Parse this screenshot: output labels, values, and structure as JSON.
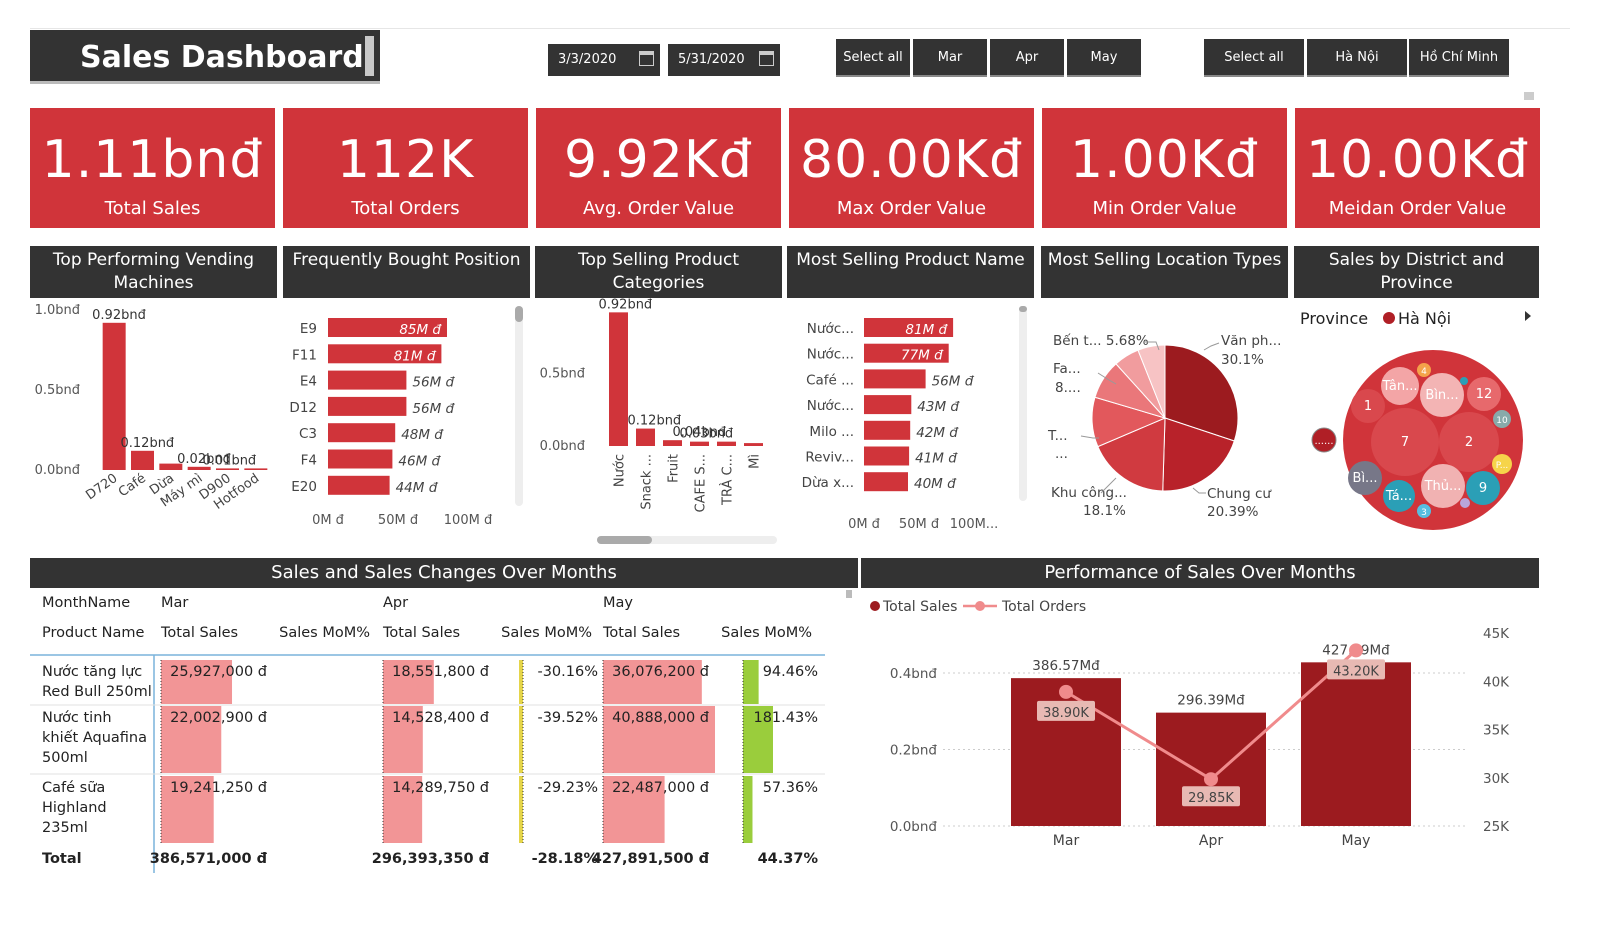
{
  "title": "Sales Dashboard",
  "dates": {
    "start": "3/3/2020",
    "end": "5/31/2020"
  },
  "month_slicer": [
    "Select all",
    "Mar",
    "Apr",
    "May"
  ],
  "city_slicer": [
    "Select all",
    "Hà Nội",
    "Hồ Chí Minh"
  ],
  "kpis": [
    {
      "value": "1.11bnđ",
      "label": "Total Sales"
    },
    {
      "value": "112K",
      "label": "Total Orders"
    },
    {
      "value": "9.92Kđ",
      "label": "Avg. Order Value"
    },
    {
      "value": "80.00Kđ",
      "label": "Max Order Value"
    },
    {
      "value": "1.00Kđ",
      "label": "Min Order Value"
    },
    {
      "value": "10.00Kđ",
      "label": "Meidan Order Value"
    }
  ],
  "panel_titles": {
    "vending": "Top Performing Vending Machines",
    "position": "Frequently Bought Position",
    "categories": "Top Selling Product Categories",
    "product": "Most Selling Product Name",
    "location": "Most Selling Location Types",
    "district": "Sales by District and Province",
    "table": "Sales and Sales Changes Over Months",
    "performance": "Performance of Sales Over Months"
  },
  "chart_data": [
    {
      "type": "bar",
      "title": "Top Performing Vending Machines",
      "categories": [
        "D720",
        "Café",
        "Dừa",
        "Máy mì",
        "D900",
        "Hotfood"
      ],
      "values": [
        0.92,
        0.12,
        0.04,
        0.02,
        0.01,
        0.01
      ],
      "data_labels": [
        "0.92bnđ",
        "0.12bnđ",
        "",
        "0.02bnđ",
        "0.01bnđ",
        ""
      ],
      "y_ticks": [
        "1.0bnđ",
        "0.5bnđ",
        "0.0bnđ"
      ],
      "ylim": [
        0,
        1.0
      ]
    },
    {
      "type": "bar",
      "orientation": "horizontal",
      "title": "Frequently Bought Position",
      "categories": [
        "E9",
        "F11",
        "E4",
        "D12",
        "C3",
        "F4",
        "E20"
      ],
      "values": [
        85,
        81,
        56,
        56,
        48,
        46,
        44
      ],
      "data_labels": [
        "85M đ",
        "81M đ",
        "56M đ",
        "56M đ",
        "48M đ",
        "46M đ",
        "44M đ"
      ],
      "x_ticks": [
        "0M đ",
        "50M đ",
        "100M đ"
      ],
      "xlim": [
        0,
        100
      ]
    },
    {
      "type": "bar",
      "title": "Top Selling Product Categories",
      "categories": [
        "Nước",
        "Snack ...",
        "Fruit",
        "CAFE S...",
        "TRÀ C...",
        "Mì"
      ],
      "values": [
        0.92,
        0.12,
        0.04,
        0.03,
        0.03,
        0.02
      ],
      "data_labels": [
        "0.92bnđ",
        "0.12bnđ",
        "0.04bnđ",
        "0.03bnđ",
        "",
        ""
      ],
      "y_ticks": [
        "0.5bnđ",
        "0.0bnđ"
      ],
      "ylim": [
        0,
        0.95
      ]
    },
    {
      "type": "bar",
      "orientation": "horizontal",
      "title": "Most Selling Product Name",
      "categories": [
        "Nước...",
        "Nước...",
        "Café ...",
        "Nước...",
        "Milo ...",
        "Reviv...",
        "Dừa x..."
      ],
      "values": [
        81,
        77,
        56,
        43,
        42,
        41,
        40
      ],
      "data_labels": [
        "81M đ",
        "77M đ",
        "56M đ",
        "43M đ",
        "42M đ",
        "41M đ",
        "40M đ"
      ],
      "x_ticks": [
        "0M đ",
        "50M đ",
        "100M..."
      ],
      "xlim": [
        0,
        100
      ]
    },
    {
      "type": "pie",
      "title": "Most Selling Location Types",
      "slices": [
        {
          "label": "Văn ph...",
          "pct": "30.1%",
          "value": 30.1,
          "color": "#9c1b1f"
        },
        {
          "label": "Chung cư",
          "pct": "20.39%",
          "value": 20.39,
          "color": "#b8222a"
        },
        {
          "label": "Khu công...",
          "pct": "18.1%",
          "value": 18.1,
          "color": "#d03a40"
        },
        {
          "label": "T...",
          "pct": "...",
          "value": 11.0,
          "color": "#e2585c"
        },
        {
          "label": "Fa...",
          "pct": "8....",
          "value": 8.7,
          "color": "#ea777a"
        },
        {
          "label": "Bến t...",
          "pct": "5.68%",
          "value": 5.68,
          "color": "#f19c9e"
        },
        {
          "label": "",
          "pct": "",
          "value": 6.03,
          "color": "#f7c3c4"
        }
      ]
    },
    {
      "type": "table",
      "title": "Sales and Sales Changes Over Months",
      "months": [
        "Mar",
        "Apr",
        "May"
      ],
      "products": [
        "Nước tăng lực Red Bull 250ml",
        "Nước tinh khiết Aquafina 500ml",
        "Café sữa Highland 235ml"
      ],
      "sales": [
        [
          25927000,
          18551800,
          36076200
        ],
        [
          22002900,
          14528400,
          40888000
        ],
        [
          19241250,
          14289750,
          22487000
        ]
      ],
      "mom": [
        [
          "",
          "-30.16%",
          "94.46%"
        ],
        [
          "",
          "-39.52%",
          "181.43%"
        ],
        [
          "",
          "-29.23%",
          "57.36%"
        ]
      ],
      "totals": {
        "sales": [
          "386,571,000 đ",
          "296,393,350 đ",
          "427,891,500 đ"
        ],
        "mom": [
          "",
          "-28.18%",
          "44.37%"
        ]
      }
    },
    {
      "type": "bar",
      "title": "Performance of Sales Over Months",
      "categories": [
        "Mar",
        "Apr",
        "May"
      ],
      "series": [
        {
          "name": "Total Sales",
          "values": [
            386.57,
            296.39,
            427.89
          ],
          "labels": [
            "386.57Mđ",
            "296.39Mđ",
            "427.89Mđ"
          ],
          "color": "#9c1b1f"
        },
        {
          "name": "Total Orders",
          "values": [
            38.9,
            29.85,
            43.2
          ],
          "labels": [
            "38.90K",
            "29.85K",
            "43.20K"
          ],
          "color": "#f08b8c"
        }
      ],
      "y_ticks_left": [
        "0.4bnđ",
        "0.2bnđ",
        "0.0bnđ"
      ],
      "y_ticks_right": [
        "45K",
        "40K",
        "35K",
        "30K",
        "25K"
      ]
    }
  ],
  "table_headers": {
    "month_name": "MonthName",
    "product_name": "Product Name",
    "total_sales": "Total Sales",
    "mom": "Sales MoM%",
    "total": "Total"
  },
  "table_cells": {
    "p1": "Nước tăng lực Red Bull 250ml",
    "p2": "Nước tinh khiết Aquafina 500ml",
    "p3": "Café sữa Highland 235ml",
    "r1": [
      "25,927,000 đ",
      "18,551,800 đ",
      "36,076,200 đ"
    ],
    "r2": [
      "22,002,900 đ",
      "14,528,400 đ",
      "40,888,000 đ"
    ],
    "r3": [
      "19,241,250 đ",
      "14,289,750 đ",
      "22,487,000 đ"
    ]
  },
  "district": {
    "legend_title": "Province",
    "legend_item": "Hà Nội",
    "more": "......",
    "bubbles": [
      "7",
      "2",
      "1",
      "Tân...",
      "Bìn...",
      "12",
      "10",
      "4",
      "Bì...",
      "Tá...",
      "3",
      "Thủ...",
      "9",
      "P..."
    ]
  },
  "colors": {
    "accent": "#d0343a",
    "dark": "#333333",
    "bar": "#d0343a",
    "deep": "#9c1b1f"
  }
}
